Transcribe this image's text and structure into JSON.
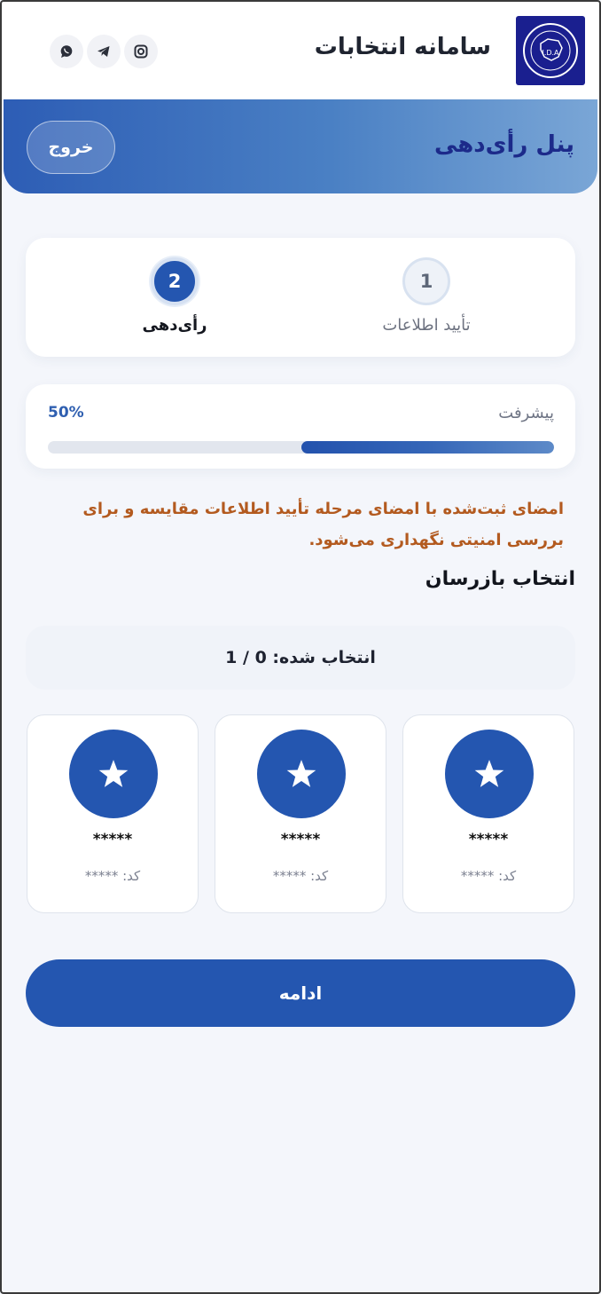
{
  "header": {
    "site_title": "سامانه انتخابات",
    "logo_text": "I.D.A",
    "social_icons": [
      "whatsapp-icon",
      "telegram-icon",
      "instagram-icon"
    ]
  },
  "panel": {
    "title": "پنل رأی‌دهی",
    "logout_label": "خروج"
  },
  "steps": [
    {
      "number": "1",
      "label": "تأیید اطلاعات",
      "state": "done"
    },
    {
      "number": "2",
      "label": "رأی‌دهی",
      "state": "active"
    }
  ],
  "progress": {
    "label": "پیشرفت",
    "percent_text": "50%",
    "value": 0.5
  },
  "notice": "امضای ثبت‌شده با امضای مرحله تأیید اطلاعات مقایسه و برای بررسی امنیتی نگهداری می‌شود.",
  "section_title": "انتخاب بازرسان",
  "selected_text": "انتخاب شده: 0 / 1",
  "candidates": [
    {
      "name": "*****",
      "code": "کد: *****"
    },
    {
      "name": "*****",
      "code": "کد: *****"
    },
    {
      "name": "*****",
      "code": "کد: *****"
    }
  ],
  "continue_label": "ادامه",
  "colors": {
    "primary": "#2456b0",
    "notice": "#b35a1f",
    "panel_title": "#1c2a8a"
  }
}
